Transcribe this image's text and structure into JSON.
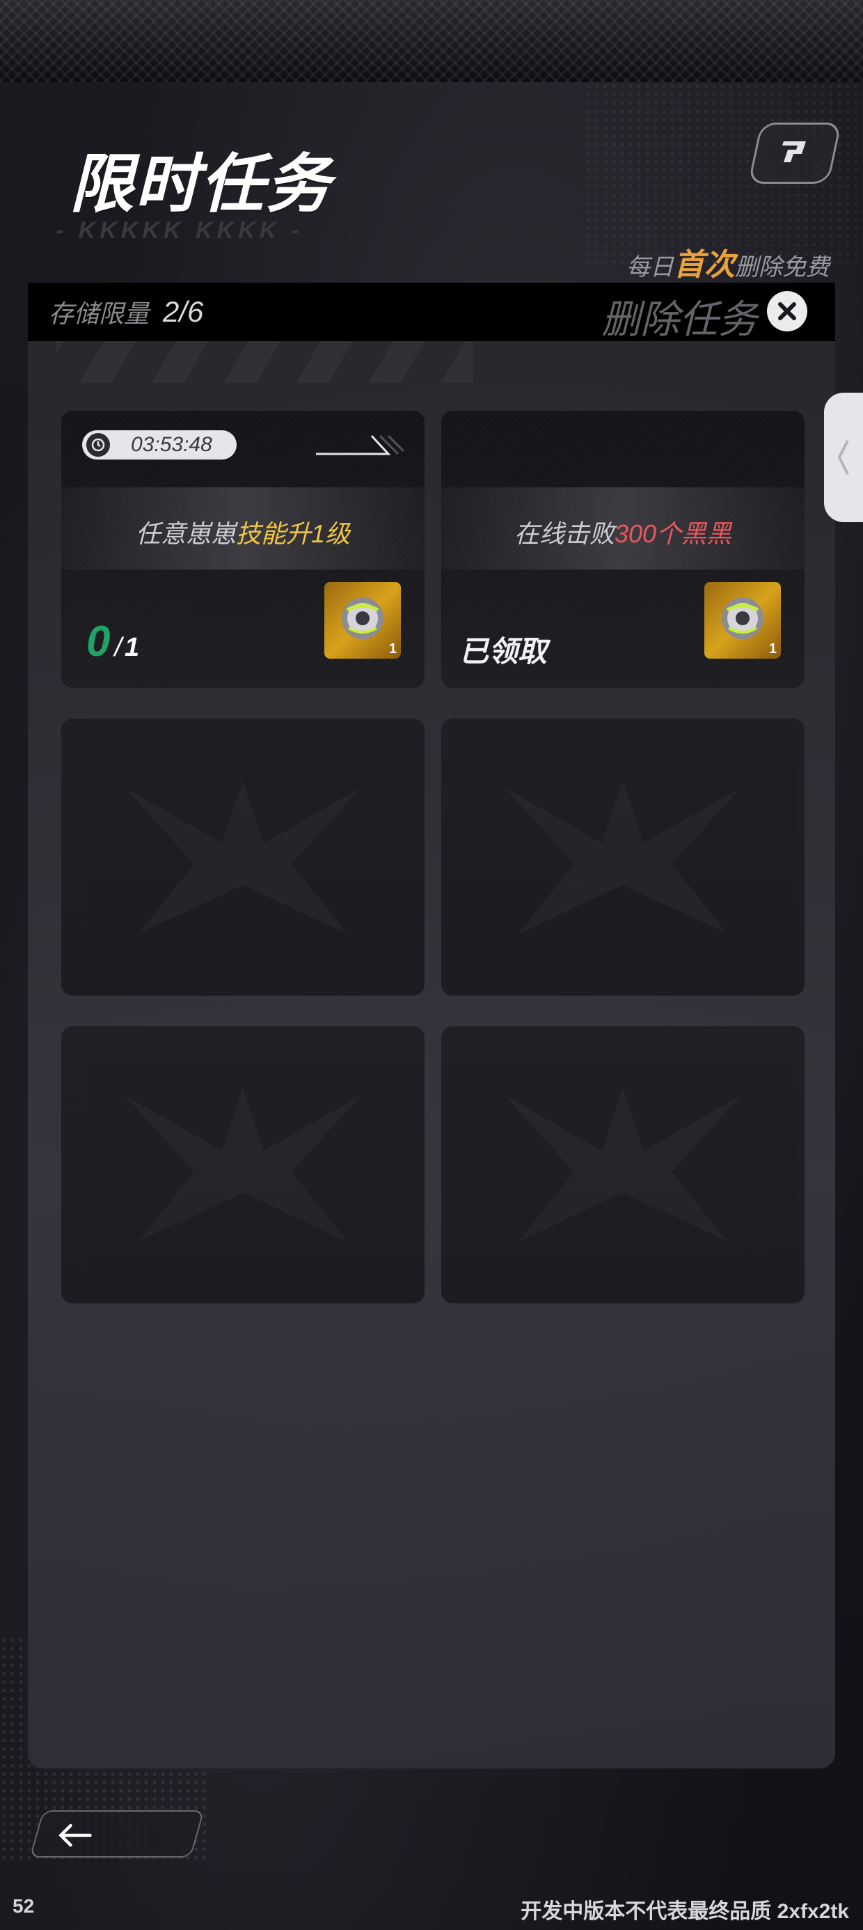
{
  "header": {
    "title": "限时任务",
    "subtitle_decoration": "- KKKKK KKKK -",
    "free_note_prefix": "每日",
    "free_note_highlight": "首次",
    "free_note_suffix": "删除免费"
  },
  "panel": {
    "storage_label": "存储限量",
    "storage_value": "2/6",
    "delete_task_label": "删除任务"
  },
  "tasks": [
    {
      "timer": "03:53:48",
      "text_prefix": "任意崽崽",
      "text_highlight": "技能升1级",
      "progress_current": "0",
      "progress_sep": "/",
      "progress_total": "1",
      "reward_count": "1",
      "highlight_color": "#f0c544"
    },
    {
      "text_prefix": "在线击败",
      "text_highlight": "300个黑黑",
      "status": "已领取",
      "reward_count": "1",
      "highlight_color": "#e8585c"
    }
  ],
  "empty_slots": 4,
  "footer": {
    "fps": "52",
    "dev_note": "开发中版本不代表最终品质 2xfx2tk"
  },
  "colors": {
    "accent_orange": "#e9a23b",
    "progress_green": "#1fa366",
    "gold_highlight": "#f0c544",
    "red_highlight": "#e8585c"
  },
  "icons": [
    "help-icon",
    "close-icon",
    "timer-icon",
    "reward-icon",
    "collapse-chevron-icon",
    "back-arrow-icon"
  ]
}
